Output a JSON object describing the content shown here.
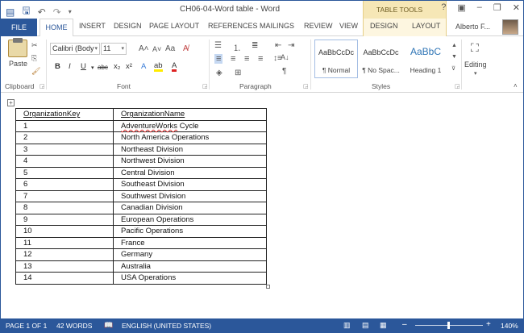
{
  "window": {
    "title": "CH06-04-Word table - Word",
    "context_tab_label": "TABLE TOOLS",
    "help": "?",
    "buttons": [
      "▣",
      "–",
      "❐",
      "✕"
    ]
  },
  "tabs": {
    "file": "FILE",
    "home": "HOME",
    "others": [
      "INSERT",
      "DESIGN",
      "PAGE LAYOUT",
      "REFERENCES",
      "MAILINGS",
      "REVIEW",
      "VIEW",
      "DESIGN",
      "LAYOUT"
    ],
    "user": "Alberto F..."
  },
  "ribbon": {
    "clipboard": {
      "paste": "Paste",
      "label": "Clipboard"
    },
    "font": {
      "name": "Calibri (Body",
      "size": "11",
      "label": "Font"
    },
    "paragraph": {
      "label": "Paragraph"
    },
    "styles": {
      "label": "Styles",
      "items": [
        {
          "sample": "AaBbCcDc",
          "name": "¶ Normal"
        },
        {
          "sample": "AaBbCcDc",
          "name": "¶ No Spac..."
        },
        {
          "sample": "AaBbC",
          "name": "Heading 1"
        }
      ]
    },
    "editing": {
      "label": "Editing"
    }
  },
  "table": {
    "headers": [
      "OrganizationKey",
      "OrganizationName"
    ],
    "rows": [
      [
        "1",
        "AdventureWorks Cycle"
      ],
      [
        "2",
        "North America Operations"
      ],
      [
        "3",
        "Northeast Division"
      ],
      [
        "4",
        "Northwest Division"
      ],
      [
        "5",
        "Central Division"
      ],
      [
        "6",
        "Southeast Division"
      ],
      [
        "7",
        "Southwest Division"
      ],
      [
        "8",
        "Canadian Division"
      ],
      [
        "9",
        "European Operations"
      ],
      [
        "10",
        "Pacific Operations"
      ],
      [
        "11",
        "France"
      ],
      [
        "12",
        "Germany"
      ],
      [
        "13",
        "Australia"
      ],
      [
        "14",
        "USA Operations"
      ]
    ]
  },
  "status": {
    "page": "PAGE 1 OF 1",
    "words": "42 WORDS",
    "language": "ENGLISH (UNITED STATES)",
    "zoom": "140%"
  },
  "colors": {
    "accent": "#2b579a",
    "context_tab": "#f6e7b6"
  }
}
